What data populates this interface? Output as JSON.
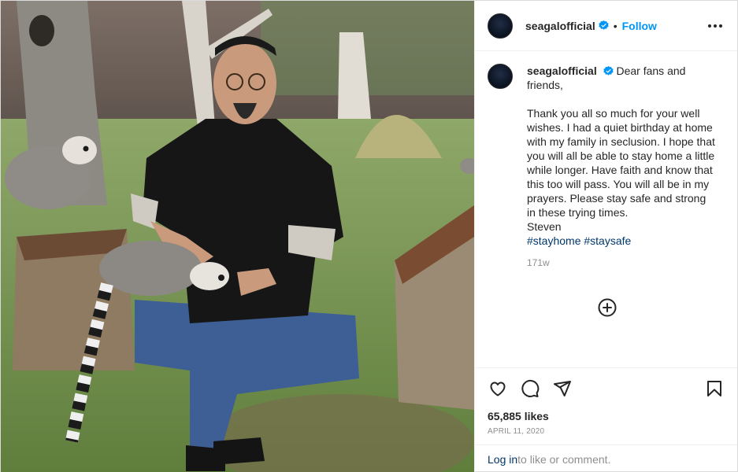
{
  "post": {
    "username": "seagalofficial",
    "follow_label": "Follow",
    "separator": "•",
    "caption_text": "Dear fans and friends,\n\nThank you all so much for your well wishes. I had a quiet birthday at home with my family in seclusion. I hope that you will all be able to stay home a little while longer. Have faith and know that this too will pass. You will all be in my prayers. Please stay safe and strong in these trying times.\nSteven",
    "hashtags": [
      "#stayhome",
      "#staysafe"
    ],
    "relative_time": "171w",
    "likes": "65,885 likes",
    "date": "APRIL 11, 2020",
    "login_link": "Log in",
    "login_rest": " to like or comment."
  },
  "icons": {
    "verified": "verified-badge-icon",
    "more": "more-options-icon",
    "load_more": "plus-circle-icon",
    "like": "heart-icon",
    "comment": "comment-icon",
    "share": "send-icon",
    "save": "bookmark-icon"
  },
  "colors": {
    "accent": "#0095f6",
    "link": "#00376b",
    "muted": "#8e8e8e",
    "text": "#262626",
    "border": "#efefef"
  }
}
